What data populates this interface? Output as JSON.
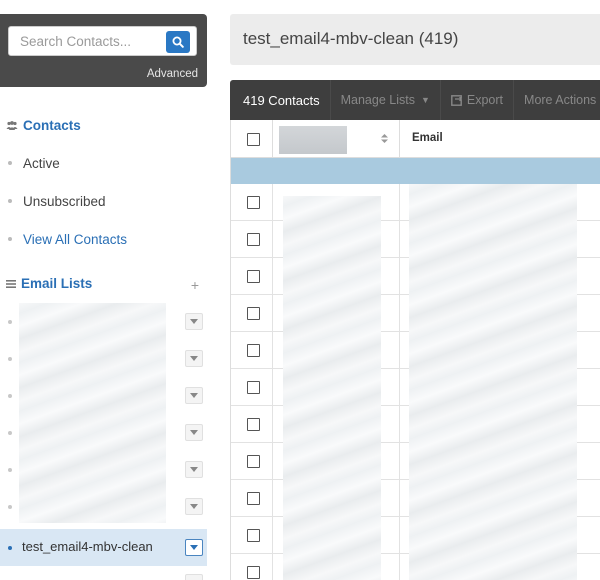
{
  "search": {
    "placeholder": "Search Contacts...",
    "advanced_label": "Advanced"
  },
  "sidebar": {
    "contacts_section": "Contacts",
    "contacts_items": [
      {
        "label": "Active"
      },
      {
        "label": "Unsubscribed"
      },
      {
        "label": "View All Contacts"
      }
    ],
    "email_lists_section": "Email Lists",
    "add_label": "+",
    "active_list": "test_email4-mbv-clean"
  },
  "main": {
    "title": "test_email4-mbv-clean (419)",
    "toolbar": {
      "count": "419 Contacts",
      "manage_lists": "Manage Lists",
      "export": "Export",
      "more_actions": "More Actions"
    },
    "grid": {
      "email_header": "Email"
    }
  },
  "colors": {
    "accent": "#2a6fb5",
    "search_button": "#2a78c4",
    "toolbar_bg": "#3e3e3e",
    "group_row": "#a9cadf",
    "active_row": "#d9e7f4"
  },
  "icons": {
    "search": "search-icon",
    "contacts": "users-icon",
    "email_lists": "list-icon",
    "export": "export-icon",
    "dropdown": "chevron-down-icon",
    "sort": "sort-icon"
  }
}
